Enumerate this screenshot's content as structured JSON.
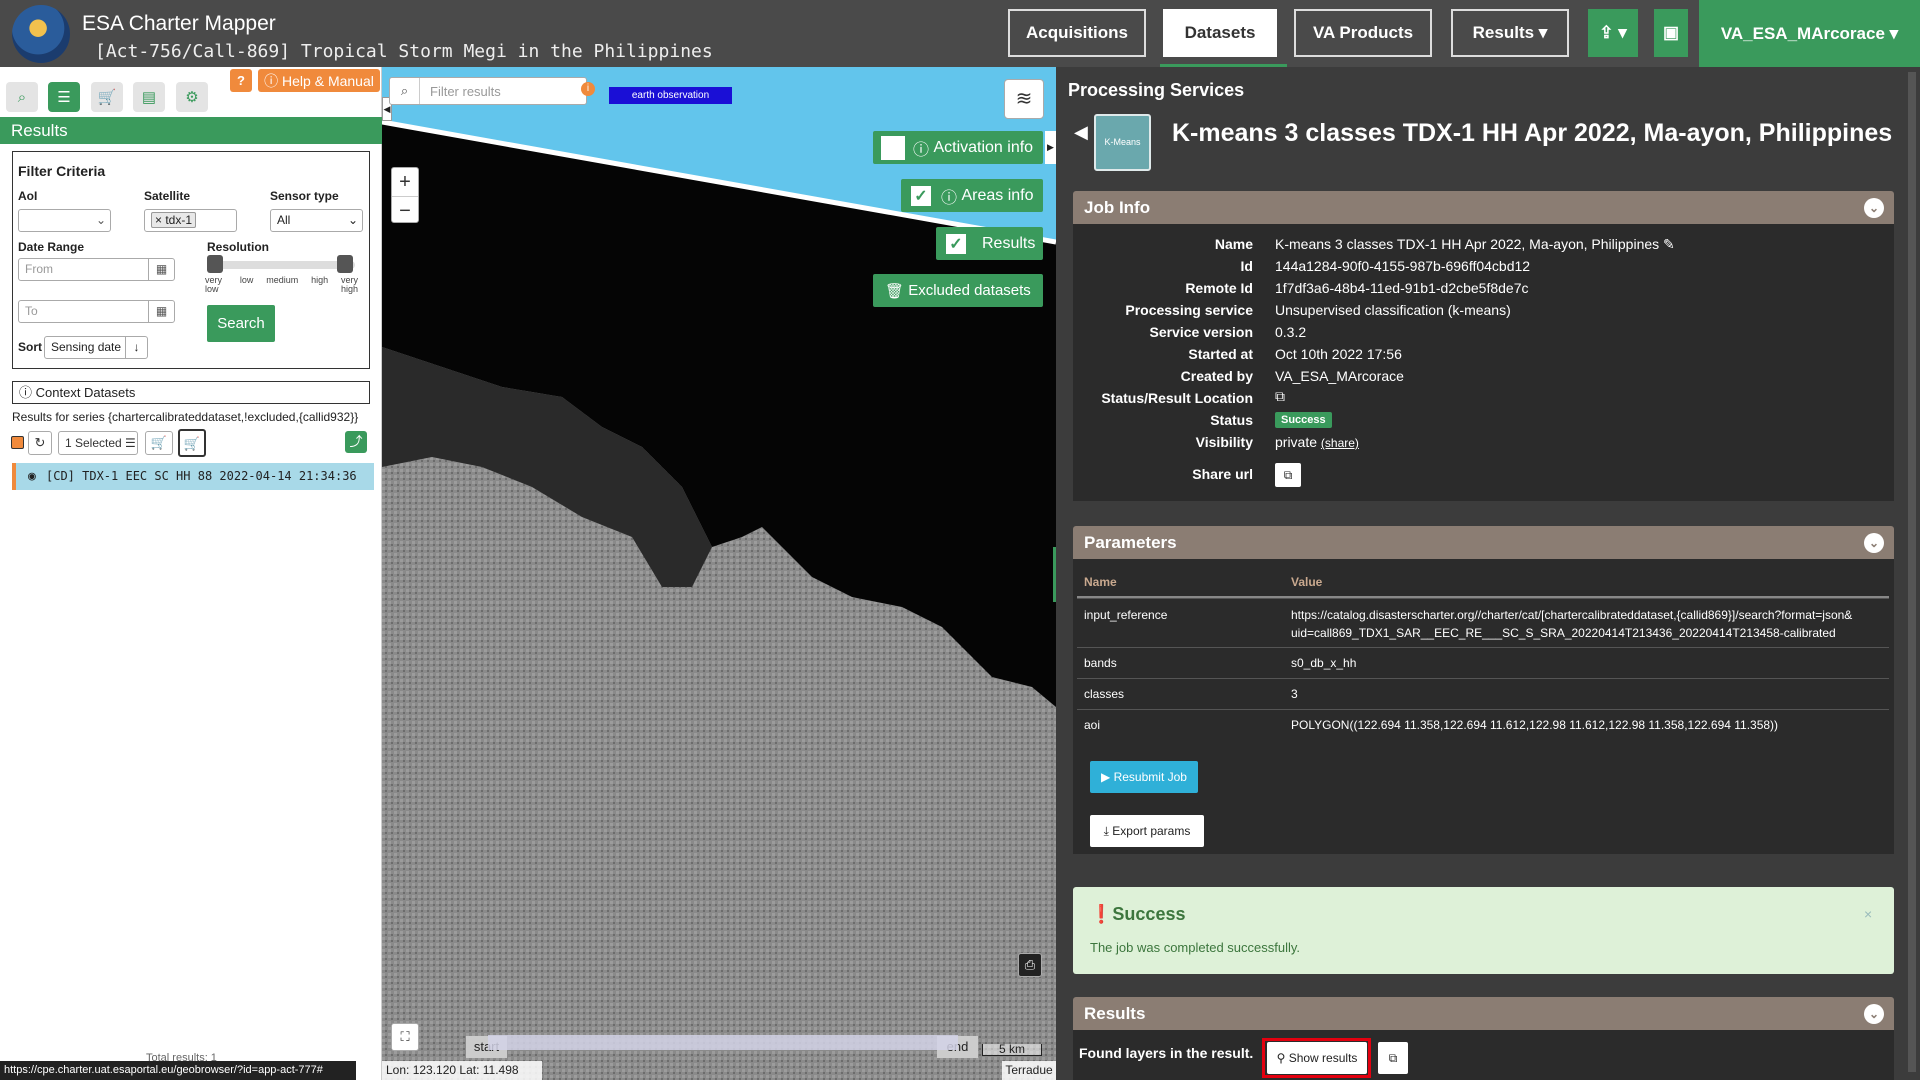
{
  "header": {
    "app_title": "ESA Charter Mapper",
    "activation": "[Act-756/Call-869] Tropical Storm Megi in the Philippines",
    "nav": {
      "acquisitions": "Acquisitions",
      "datasets": "Datasets",
      "va_products": "VA Products",
      "results": "Results ▾"
    },
    "user": "VA_ESA_MArcorace ▾"
  },
  "left": {
    "help": "Help & Manual",
    "results_title": "Results",
    "filter": {
      "title": "Filter Criteria",
      "aoi_label": "AoI",
      "satellite_label": "Satellite",
      "satellite_value": "tdx-1",
      "sensor_label": "Sensor type",
      "sensor_value": "All",
      "date_label": "Date Range",
      "from_ph": "From",
      "to_ph": "To",
      "resolution_label": "Resolution",
      "res_ticks": [
        "very low",
        "low",
        "medium",
        "high",
        "very high"
      ],
      "sort_label": "Sort",
      "sort_value": "Sensing date",
      "search": "Search"
    },
    "context": "Context Datasets",
    "series_text": "Results for series {chartercalibrateddataset,!excluded,{callid932}}",
    "selected": "1 Selected",
    "result_item": "[CD] TDX-1 EEC SC HH 88 2022-04-14 21:34:36",
    "total": "Total results: 1",
    "url": "https://cpe.charter.uat.esaportal.eu/geobrowser/?id=app-act-777#"
  },
  "map": {
    "filter_ph": "Filter results",
    "eo_tag": "earth observation",
    "activation_info": "Activation info",
    "areas_info": "Areas info",
    "results": "Results",
    "excluded": "Excluded datasets",
    "start": "start",
    "end": "end",
    "scale": "5 km",
    "coords": "Lon: 123.120 Lat: 11.498",
    "attrib": "Terradue"
  },
  "right": {
    "panel_title": "Processing Services",
    "service_icon": "K-Means",
    "job_title": "K-means 3 classes TDX-1 HH Apr 2022, Ma-ayon, Philippines",
    "job_info": {
      "title": "Job Info",
      "rows": [
        {
          "k": "Name",
          "v": "K-means 3 classes TDX-1 HH Apr 2022, Ma-ayon, Philippines ✎"
        },
        {
          "k": "Id",
          "v": "144a1284-90f0-4155-987b-696ff04cbd12"
        },
        {
          "k": "Remote Id",
          "v": "1f7df3a6-48b4-11ed-91b1-d2cbe5f8de7c"
        },
        {
          "k": "Processing service",
          "v": "Unsupervised classification (k-means)"
        },
        {
          "k": "Service version",
          "v": "0.3.2"
        },
        {
          "k": "Started at",
          "v": "Oct 10th 2022 17:56"
        },
        {
          "k": "Created by",
          "v": "VA_ESA_MArcorace"
        },
        {
          "k": "Status/Result Location",
          "v": "⧉"
        }
      ],
      "status_label": "Status",
      "status_value": "Success",
      "visibility_label": "Visibility",
      "visibility_value": "private",
      "share": "(share)",
      "share_url_label": "Share url"
    },
    "parameters": {
      "title": "Parameters",
      "col_name": "Name",
      "col_value": "Value",
      "rows": [
        {
          "k": "input_reference",
          "v": "https://catalog.disasterscharter.org//charter/cat/[chartercalibrateddataset,{callid869}]/search?format=json&",
          "v2": "uid=call869_TDX1_SAR__EEC_RE___SC_S_SRA_20220414T213436_20220414T213458-calibrated"
        },
        {
          "k": "bands",
          "v": "s0_db_x_hh",
          "v2": ""
        },
        {
          "k": "classes",
          "v": "3",
          "v2": ""
        },
        {
          "k": "aoi",
          "v": "POLYGON((122.694 11.358,122.694 11.612,122.98 11.612,122.98 11.358,122.694 11.358))",
          "v2": ""
        }
      ],
      "resubmit": "Resubmit Job",
      "export": "Export params"
    },
    "success": {
      "title": "Success",
      "text": "The job was completed successfully."
    },
    "results": {
      "title": "Results",
      "found": "Found layers in the result.",
      "show": "Show results"
    }
  },
  "colors": {
    "green": "#3a9a5c",
    "orange": "#f08a3c",
    "section": "#8b7d73",
    "highlight": "#e3000f"
  }
}
